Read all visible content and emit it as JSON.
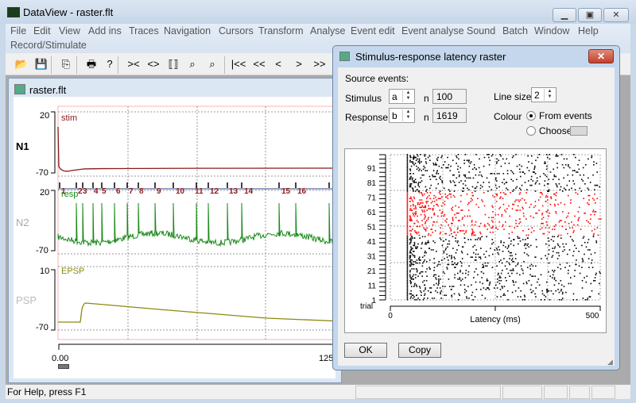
{
  "app": {
    "title": "DataView - raster.flt",
    "icon": "oscilloscope-icon"
  },
  "window_controls": {
    "minimize": "minimize-icon",
    "maximize": "restore-icon",
    "close": "close-icon"
  },
  "menu": [
    "File",
    "Edit",
    "View",
    "Add ins",
    "Traces",
    "Navigation",
    "Cursors",
    "Transform",
    "Analyse",
    "Event edit",
    "Event analyse",
    "Sound",
    "Batch",
    "Window",
    "Help",
    "Record/Stimulate"
  ],
  "toolbar": {
    "icons": [
      "open-folder-icon",
      "save-icon",
      "copy-icon",
      "print-icon",
      "help-icon",
      "zoom-in-time-icon",
      "zoom-out-time-icon",
      "fit-icon",
      "zoom-red-icon",
      "zoom-cursor-icon",
      "first-icon",
      "fast-back-icon",
      "back-icon",
      "forward-icon",
      "fast-forward-icon"
    ],
    "glyphs": [
      "📂",
      "💾",
      "⎘",
      "🖶",
      "?",
      "><",
      "<>",
      "⟦⟧",
      "⌕",
      "⌕",
      "|<<",
      "<<",
      "<",
      ">",
      ">>"
    ]
  },
  "document": {
    "title": "raster.flt",
    "traces": [
      {
        "name": "N1",
        "label": "stim",
        "ymax": "20",
        "ymin": "-70",
        "color": "#8b1a1a"
      },
      {
        "name": "N2",
        "label": "resp",
        "ymax": "20",
        "ymin": "-70",
        "color": "#1a8a1a"
      },
      {
        "name": "PSP",
        "label": "EPSP",
        "ymax": "10",
        "ymin": "-70",
        "color": "#8a8a10"
      }
    ],
    "event_numbers": [
      "1",
      "2",
      "3",
      "4",
      "5",
      "6",
      "7",
      "8",
      "9",
      "10",
      "11",
      "12",
      "13",
      "14",
      "15",
      "16"
    ],
    "time_axis": {
      "start": "0.00",
      "end": "125"
    }
  },
  "status": {
    "text": "For Help, press F1"
  },
  "dialog": {
    "title": "Stimulus-response latency raster",
    "source_events_label": "Source events:",
    "stimulus_label": "Stimulus",
    "stimulus_value": "a",
    "stimulus_n_label": "n",
    "stimulus_n": "100",
    "response_label": "Response",
    "response_value": "b",
    "response_n_label": "n",
    "response_n": "1619",
    "line_size_label": "Line size",
    "line_size": "2",
    "colour_label": "Colour",
    "from_events": "From events",
    "choose": "Choose",
    "colour_mode": "From events",
    "ok": "OK",
    "copy": "Copy"
  },
  "chart_data": {
    "type": "scatter",
    "xlabel": "Latency (ms)",
    "ylabel": "trial",
    "xlim": [
      0,
      500
    ],
    "ylim": [
      1,
      100
    ],
    "x_ticks": [
      "0",
      "500"
    ],
    "y_ticks": [
      "1",
      "11",
      "21",
      "31",
      "41",
      "51",
      "61",
      "71",
      "81",
      "91"
    ],
    "grid": true,
    "series": [
      {
        "color": "#000000",
        "trials": "1-44, 75-100"
      },
      {
        "color": "#ff0000",
        "trials": "45-74"
      }
    ],
    "notes_visible": "dense column of responses near 40 ms latency"
  }
}
